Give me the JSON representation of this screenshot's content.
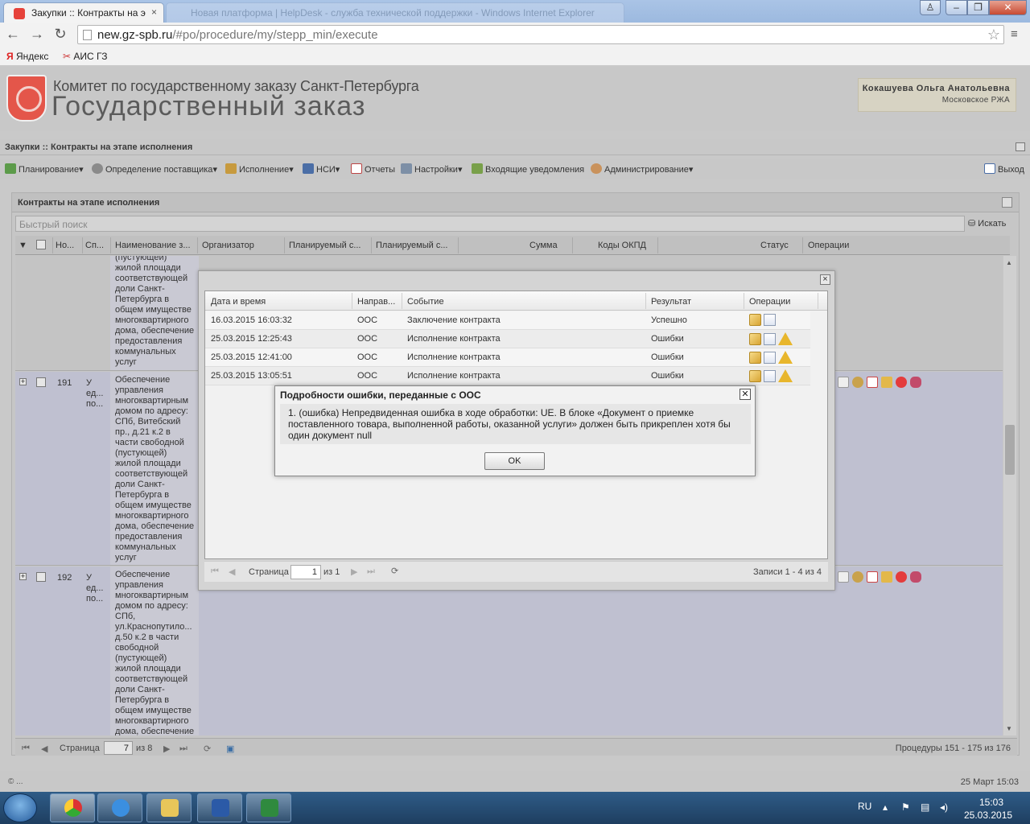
{
  "browser": {
    "tabs": [
      {
        "label": "Закупки :: Контракты на э"
      },
      {
        "label": "Новая платформа | HelpDesk - служба технической поддержки - Windows Internet Explorer"
      }
    ],
    "url": {
      "host": "new.gz-spb.ru",
      "path": "/#po/procedure/my/stepp_min/execute"
    },
    "bookmarks": [
      "Яндекс",
      "АИС ГЗ"
    ]
  },
  "header": {
    "line1": "Комитет по государственному заказу Санкт-Петербурга",
    "line2": "Государственный заказ",
    "user_name": "Кокашуева Ольга Анатольевна",
    "user_org": "Московское РЖА"
  },
  "app": {
    "title": "Закупки :: Контракты на этапе исполнения",
    "menu": [
      "Планирование",
      "Определение поставщика",
      "Исполнение",
      "НСИ",
      "Отчеты",
      "Настройки",
      "Входящие уведомления",
      "Администрирование"
    ],
    "logout": "Выход"
  },
  "panel": {
    "title": "Контракты на этапе исполнения",
    "search_placeholder": "Быстрый поиск",
    "search_button": "Искать",
    "columns": [
      "Но...",
      "Сп...",
      "Наименование з...",
      "Организатор",
      "Планируемый с...",
      "Планируемый с...",
      "Сумма",
      "Коды ОКПД",
      "Статус",
      "Операции"
    ],
    "rows": [
      {
        "num": "",
        "sp": "",
        "text": "(пустующей)\nжилой площади\nсоответствующей\nдоли Санкт-\nПетербурга в\nобщем имуществе\nмногоквартирного\nдома, обеспечение\nпредоставления\nкоммунальных\nуслуг"
      },
      {
        "num": "191",
        "sp": "У\nед...\nпо...",
        "text": "Обеспечение\nуправления\nмногоквартирным\nдомом по адресу:\nСПб, Витебский\nпр., д.21 к.2 в\nчасти свободной\n(пустующей)\nжилой площади\nсоответствующей\nдоли Санкт-\nПетербурга в\nобщем имуществе\nмногоквартирного\nдома, обеспечение\nпредоставления\nкоммунальных\nуслуг"
      },
      {
        "num": "192",
        "sp": "У\nед...\nпо...",
        "text": "Обеспечение\nуправления\nмногоквартирным\nдомом по адресу:\nСПб,\nул.Краснопутило...\nд.50 к.2 в части\nсвободной\n(пустующей)\nжилой площади\nсоответствующей\nдоли Санкт-\nПетербурга в\nобщем имуществе\nмногоквартирного\nдома, обеспечение"
      }
    ],
    "pager": {
      "label": "Страница",
      "page": "7",
      "of": "из 8",
      "summary": "Процедуры 151 - 175 из 176"
    }
  },
  "history_dialog": {
    "columns": [
      "Дата и время",
      "Направ...",
      "Событие",
      "Результат",
      "Операции"
    ],
    "rows": [
      {
        "date": "16.03.2015 16:03:32",
        "dir": "ООС",
        "event": "Заключение контракта",
        "result": "Успешно",
        "warn": false
      },
      {
        "date": "25.03.2015 12:25:43",
        "dir": "ООС",
        "event": "Исполнение контракта",
        "result": "Ошибки",
        "warn": true
      },
      {
        "date": "25.03.2015 12:41:00",
        "dir": "ООС",
        "event": "Исполнение контракта",
        "result": "Ошибки",
        "warn": true
      },
      {
        "date": "25.03.2015 13:05:51",
        "dir": "ООС",
        "event": "Исполнение контракта",
        "result": "Ошибки",
        "warn": true
      }
    ],
    "pager": {
      "label": "Страница",
      "page": "1",
      "of": "из 1",
      "summary": "Записи 1 - 4 из 4"
    }
  },
  "error_dialog": {
    "title": "Подробности ошибки, переданные с ООС",
    "message": "1. (ошибка) Непредвиденная ошибка в ходе обработки: UE. В блоке «Документ о приемке поставленного товара, выполненной работы, оказанной услуги» должен быть прикреплен хотя бы один документ null",
    "ok": "OK"
  },
  "footer": {
    "left": "© ...",
    "right": "25 Март 15:03"
  },
  "taskbar": {
    "lang": "RU",
    "time": "15:03",
    "date": "25.03.2015"
  },
  "colors": {
    "accent_red": "#e4564a",
    "warning": "#e8b62c",
    "taskbar": "#2f5c87"
  }
}
